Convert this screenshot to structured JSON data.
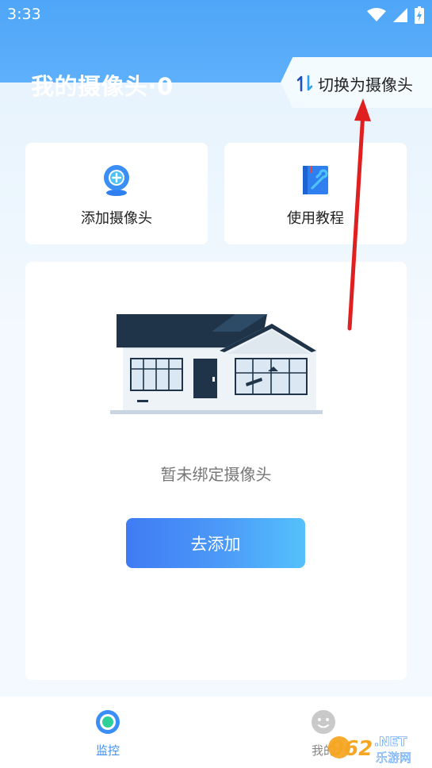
{
  "status_bar": {
    "time": "3:33",
    "icons": [
      "wifi-icon",
      "signal-icon",
      "battery-icon"
    ]
  },
  "header": {
    "title": "我的摄像头·0",
    "switch_label": "切换为摄像头"
  },
  "quick_actions": [
    {
      "label": "添加摄像头",
      "icon": "add-camera-icon"
    },
    {
      "label": "使用教程",
      "icon": "tutorial-book-icon"
    }
  ],
  "empty_state": {
    "message": "暂未绑定摄像头",
    "button_label": "去添加"
  },
  "tab_bar": {
    "tabs": [
      {
        "label": "监控",
        "active": true
      },
      {
        "label": "我的",
        "active": false
      }
    ]
  },
  "watermark": {
    "text_main": "962.NET",
    "text_sub": "乐游网"
  },
  "colors": {
    "accent": "#3a8ef6",
    "header": "#4fa6f8",
    "annotation_arrow": "#e02020"
  }
}
